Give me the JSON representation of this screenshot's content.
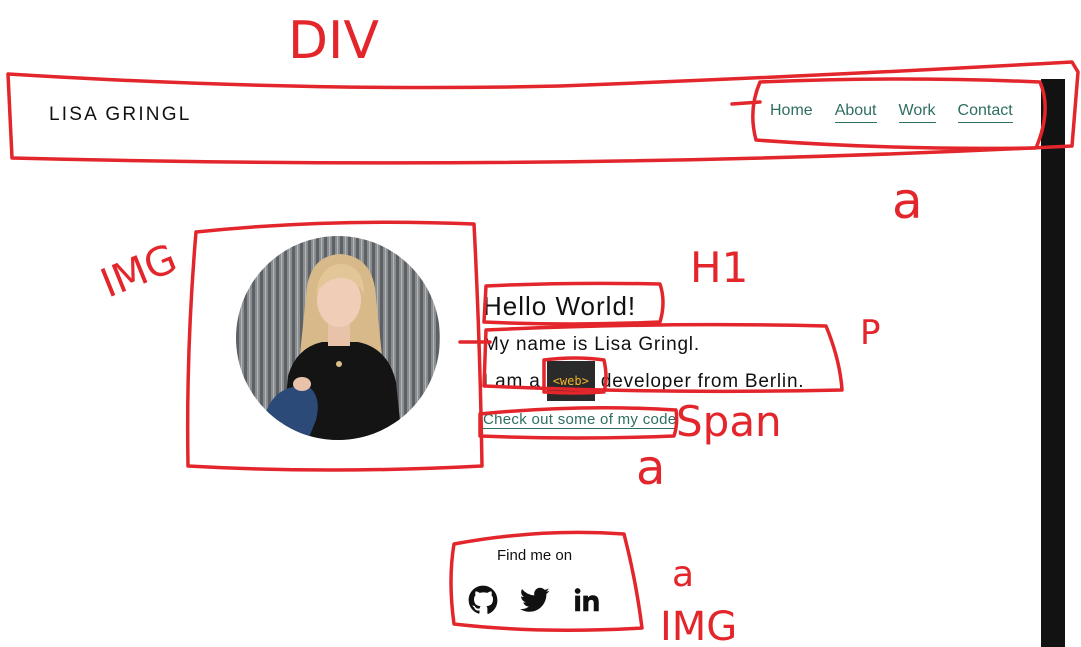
{
  "header": {
    "brand": "LISA GRINGL",
    "nav": [
      {
        "label": "Home"
      },
      {
        "label": "About"
      },
      {
        "label": "Work"
      },
      {
        "label": "Contact"
      }
    ]
  },
  "intro": {
    "heading": "Hello World!",
    "line1": "My name is Lisa Gringl.",
    "line2_prefix": "I am a",
    "web_tag": "<web>",
    "line2_suffix": "developer from Berlin.",
    "code_link": "Check out some of my code"
  },
  "social": {
    "heading": "Find me on",
    "icons": [
      "github-icon",
      "twitter-icon",
      "linkedin-icon"
    ]
  },
  "annotations": {
    "div": "DIV",
    "a_nav": "a",
    "img": "IMG",
    "h1": "H1",
    "p": "P",
    "span": "Span",
    "a_link": "a",
    "a_social": "a",
    "img_social": "IMG"
  },
  "colors": {
    "link": "#2f6e62",
    "annotation": "#e3262b",
    "tag_bg": "#2a2a2a",
    "tag_text": "#f0b429"
  }
}
